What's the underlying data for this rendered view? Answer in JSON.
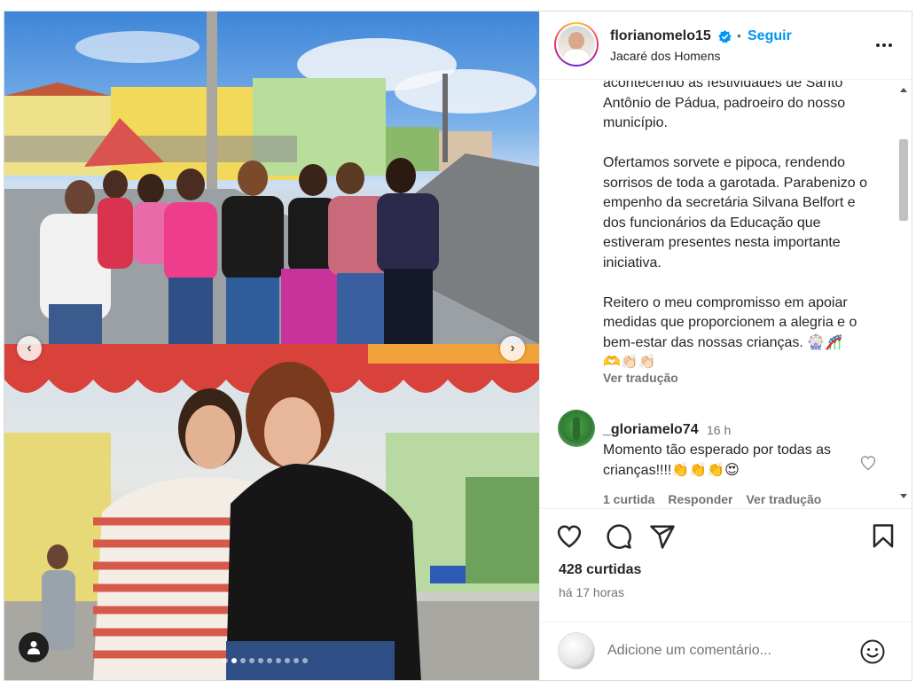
{
  "post": {
    "username": "florianomelo15",
    "follow_label": "Seguir",
    "separator": "•",
    "location": "Jacaré dos Homens"
  },
  "caption": {
    "paragraphs": [
      "acontecendo as festividades de Santo Antônio de Pádua, padroeiro do nosso município.",
      "Ofertamos sorvete e pipoca, rendendo sorrisos de toda a garotada. Parabenizo o empenho da secretária Silvana Belfort e dos funcionários da Educação que estiveram presentes nesta importante iniciativa.",
      "Reitero o meu compromisso em apoiar medidas que proporcionem a alegria e o bem-estar das nossas crianças. 🎡🎢\n🫶👏🏻👏🏻"
    ],
    "see_translation": "Ver tradução"
  },
  "comment": {
    "username": "_gloriamelo74",
    "time": "16 h",
    "text": "Momento tão esperado por todas as crianças!!!!👏👏👏😍",
    "likes": "1 curtida",
    "reply": "Responder",
    "translate": "Ver tradução"
  },
  "stats": {
    "likes": "428 curtidas",
    "posted_ago": "há 17 horas"
  },
  "add_comment": {
    "placeholder": "Adicione um comentário..."
  },
  "carousel": {
    "total_slides": 10,
    "active_slide": 2
  },
  "colors": {
    "accent": "#0095f6",
    "text": "#262626",
    "secondary": "#737373"
  },
  "icons": {
    "verified": "verified-badge-icon",
    "like": "heart-icon",
    "comment": "comment-icon",
    "share": "paper-plane-icon",
    "save": "bookmark-icon",
    "more": "more-options-icon",
    "emoji": "emoji-icon",
    "tag": "user-tag-icon"
  }
}
